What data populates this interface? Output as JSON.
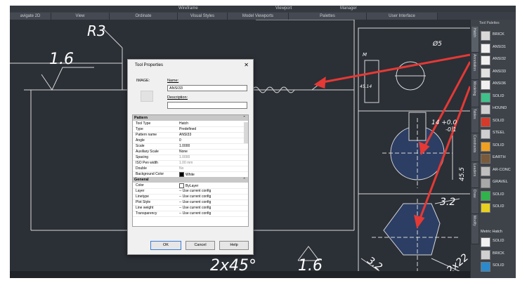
{
  "ribbon": {
    "top_items": [
      "Wireframe",
      "Viewport",
      "Manager"
    ],
    "tabs": [
      "avigate 2D",
      "View",
      "Ordinate",
      "Visual Styles",
      "Model Viewports",
      "Palettes",
      "User Interface"
    ]
  },
  "drawing": {
    "labels": {
      "r3": "R3",
      "rough1": "1.6",
      "chamfer": "2x45°",
      "rough2": "1.6",
      "dim_14": "14 +0.0",
      "dim_14b": "-0.1",
      "dim_45": "45.5",
      "dim_32": "3.2",
      "dim_2x22": "2x22",
      "dim_32b": "3.2",
      "dim_a": "Ø5",
      "dim_b": "M",
      "dim_c": "45.14"
    },
    "colors": {
      "background": "#2b2f36",
      "lines": "#e8e8e8",
      "arrow": "#e53935",
      "hatch": "#2f4a8a"
    }
  },
  "palette": {
    "title": "Tool Palettes",
    "tabs": [
      "Hatch",
      "Annotation",
      "Modeling",
      "Tables",
      "Constraints",
      "Leaders",
      "Draw",
      "Modify"
    ],
    "items": [
      {
        "label": "BRICK",
        "icon": "brick-swatch",
        "color": "#d8d8d8"
      },
      {
        "label": "ANSI31",
        "icon": "ansi31-swatch",
        "color": "#f0f0f0"
      },
      {
        "label": "ANSI32",
        "icon": "ansi32-swatch",
        "color": "#f0f0f0"
      },
      {
        "label": "ANSI33",
        "icon": "ansi33-swatch",
        "color": "#e0e0e0"
      },
      {
        "label": "ANSI36",
        "icon": "ansi36-swatch",
        "color": "#f0f0f0"
      },
      {
        "label": "SOLID",
        "icon": "solid-swatch",
        "color": "#3ec28a"
      },
      {
        "label": "HOUND",
        "icon": "hound-swatch",
        "color": "#cfcfcf"
      },
      {
        "label": "SOLID",
        "icon": "solid-swatch",
        "color": "#d63a2a"
      },
      {
        "label": "STEEL",
        "icon": "steel-swatch",
        "color": "#cfcfcf"
      },
      {
        "label": "SOLID",
        "icon": "solid-swatch",
        "color": "#f0a020"
      },
      {
        "label": "EARTH",
        "icon": "earth-swatch",
        "color": "#7a5a3a"
      },
      {
        "label": "AR-CONC",
        "icon": "ar-conc-swatch",
        "color": "#bfbfbf"
      },
      {
        "label": "GRAVEL",
        "icon": "gravel-swatch",
        "color": "#a8a8a8"
      },
      {
        "label": "SOLID",
        "icon": "solid-swatch",
        "color": "#2fb34a"
      },
      {
        "label": "SOLID",
        "icon": "solid-swatch",
        "color": "#e8d020"
      }
    ],
    "metric_header": "Metric Hatch",
    "metric_items": [
      {
        "label": "SOLID",
        "icon": "solid-swatch",
        "color": "#f0f0f0"
      },
      {
        "label": "BRICK",
        "icon": "brick-swatch",
        "color": "#d0d0d0"
      },
      {
        "label": "SOLID",
        "icon": "solid-swatch",
        "color": "#2a8ad0"
      }
    ]
  },
  "dialog": {
    "title": "Tool Properties",
    "close": "✕",
    "image_label": "IMAGE:",
    "name_label": "Name:",
    "name_value": "ANSI33",
    "description_label": "Description:",
    "description_value": "",
    "pattern_section": "Pattern",
    "pattern_rows": [
      {
        "key": "Tool Type",
        "value": "Hatch"
      },
      {
        "key": "Type",
        "value": "Predefined"
      },
      {
        "key": "Pattern name",
        "value": "ANSI33"
      },
      {
        "key": "Angle",
        "value": "0"
      },
      {
        "key": "Scale",
        "value": "1.0000"
      },
      {
        "key": "Auxiliary Scale",
        "value": "None"
      },
      {
        "key": "Spacing",
        "value": "1.0000",
        "gray": true
      },
      {
        "key": "ISO Pen width",
        "value": "1.00 mm",
        "gray": true
      },
      {
        "key": "Double",
        "value": "No",
        "gray": true
      },
      {
        "key": "Background Color",
        "value": "White",
        "check": "black"
      }
    ],
    "general_section": "General",
    "general_rows": [
      {
        "key": "Color",
        "value": "ByLayer",
        "check": "white"
      },
      {
        "key": "Layer",
        "value": "-- Use current config"
      },
      {
        "key": "Linetype",
        "value": "-- Use current config"
      },
      {
        "key": "Plot Style",
        "value": "-- Use current config"
      },
      {
        "key": "Line weight",
        "value": "-- Use current config"
      },
      {
        "key": "Transparency",
        "value": "-- Use current config"
      }
    ],
    "ok": "OK",
    "cancel": "Cancel",
    "help": "Help"
  }
}
